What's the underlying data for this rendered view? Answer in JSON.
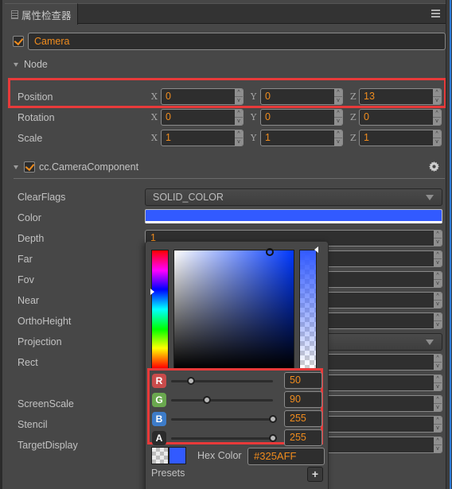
{
  "panel": {
    "tab_title": "属性检查器",
    "tab_icon": "document-icon",
    "menu_icon": "hamburger-menu-icon"
  },
  "node": {
    "enabled": true,
    "name": "Camera",
    "section_label": "Node",
    "position": {
      "label": "Position",
      "x": "0",
      "y": "0",
      "z": "13"
    },
    "rotation": {
      "label": "Rotation",
      "x": "0",
      "y": "0",
      "z": "0"
    },
    "scale": {
      "label": "Scale",
      "x": "1",
      "y": "1",
      "z": "1"
    },
    "axes": {
      "x": "X",
      "y": "Y",
      "z": "Z"
    }
  },
  "component": {
    "enabled": true,
    "name": "cc.CameraComponent",
    "settings_icon": "gear-icon",
    "props": {
      "clear_flags": {
        "label": "ClearFlags",
        "value": "SOLID_COLOR"
      },
      "color": {
        "label": "Color",
        "value": "#325AFF"
      },
      "depth": {
        "label": "Depth",
        "value": "1"
      },
      "far": {
        "label": "Far"
      },
      "fov": {
        "label": "Fov"
      },
      "near": {
        "label": "Near"
      },
      "ortho_height": {
        "label": "OrthoHeight"
      },
      "projection": {
        "label": "Projection"
      },
      "rect": {
        "label": "Rect"
      },
      "screen_scale": {
        "label": "ScreenScale"
      },
      "stencil": {
        "label": "Stencil"
      },
      "target_display": {
        "label": "TargetDisplay"
      }
    }
  },
  "color_picker": {
    "hue_position": 0.63,
    "alpha_position": 1.0,
    "channels": [
      {
        "key": "R",
        "value": "50",
        "fraction": 0.196,
        "color": "#c94b4b"
      },
      {
        "key": "G",
        "value": "90",
        "fraction": 0.353,
        "color": "#6aa84f"
      },
      {
        "key": "B",
        "value": "255",
        "fraction": 1.0,
        "color": "#3d7cc9"
      },
      {
        "key": "A",
        "value": "255",
        "fraction": 1.0,
        "color": "#2b2b2b"
      }
    ],
    "hex_label": "Hex Color",
    "hex_value": "#325AFF",
    "presets_label": "Presets",
    "add_preset_label": "+"
  },
  "highlight_color": "#e83a3a",
  "accent_color": "#f08c1e"
}
